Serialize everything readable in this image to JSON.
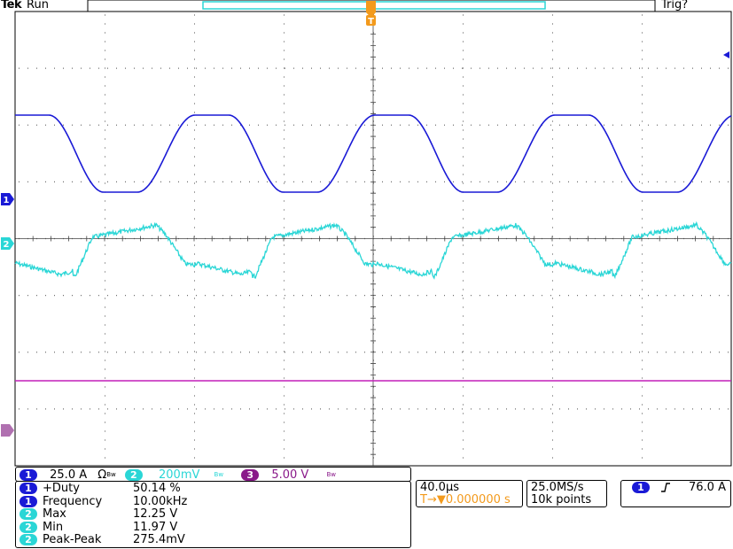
{
  "header": {
    "brand": "Tek",
    "status": "Run",
    "trigger_status": "Trig?"
  },
  "colors": {
    "ch1": "#1a1ad6",
    "ch2": "#2ad6d6",
    "ch3": "#c21fb8",
    "trigger": "#f39a1c",
    "grid": "#8a8a8a"
  },
  "markers": {
    "ch1": "1",
    "ch2": "2",
    "ch3": "3",
    "trigger": "T"
  },
  "channels": [
    {
      "id": "1",
      "scale": "25.0 A",
      "coupling": "Ω",
      "bw": "Bw"
    },
    {
      "id": "2",
      "scale": "200mV",
      "bw": "Bw"
    },
    {
      "id": "3",
      "scale": "5.00 V",
      "bw": "Bw"
    }
  ],
  "measurements": [
    {
      "ch": "1",
      "name": "+Duty",
      "value": "50.14 %"
    },
    {
      "ch": "1",
      "name": "Frequency",
      "value": "10.00kHz"
    },
    {
      "ch": "2",
      "name": "Max",
      "value": "12.25 V"
    },
    {
      "ch": "2",
      "name": "Min",
      "value": "11.97 V"
    },
    {
      "ch": "2",
      "name": "Peak-Peak",
      "value": "275.4mV"
    }
  ],
  "timebase": {
    "scale": "40.0µs",
    "trigger_delay": "T→▼0.000000 s"
  },
  "acquisition": {
    "sample_rate": "25.0MS/s",
    "record_length": "10k points"
  },
  "trigger": {
    "source": "1",
    "slope_icon": "rising-edge",
    "level": "76.0 A"
  }
}
